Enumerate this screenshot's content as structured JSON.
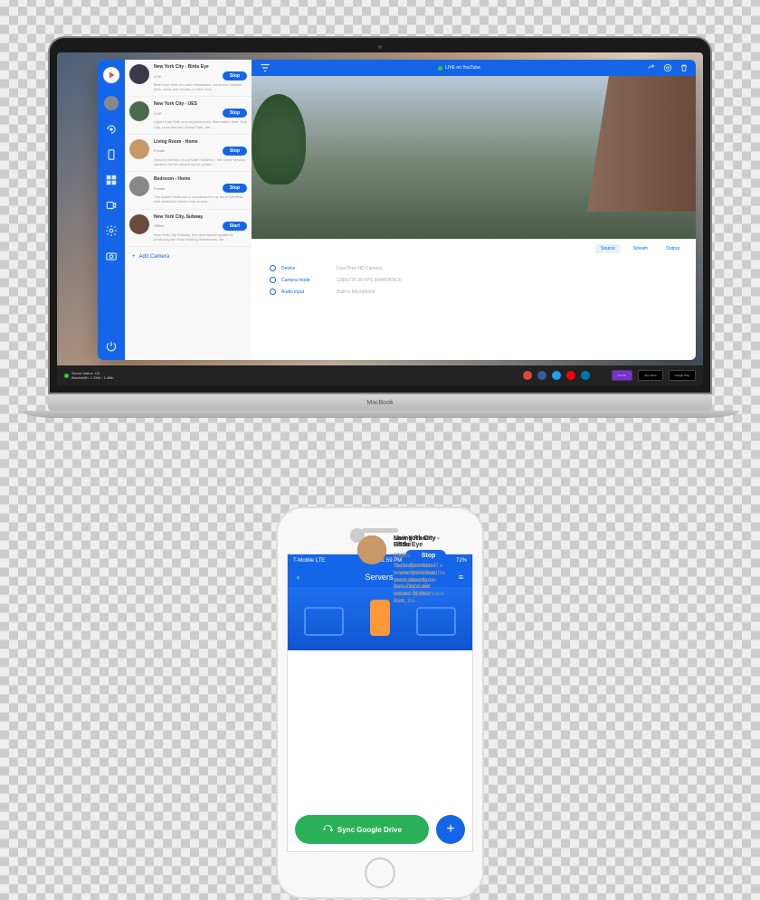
{
  "macbook_label": "MacBook",
  "topbar": {
    "live": "LIVE on YouTube"
  },
  "sidebar_icons": [
    "logo",
    "avatar",
    "camera",
    "phone",
    "grid",
    "record",
    "settings",
    "snapshot",
    "power"
  ],
  "cameras": [
    {
      "title": "New York City - Birds Eye",
      "status": "LIVE",
      "btn": "Stop",
      "desc": "Bird's eye view of Lower Manhattan, zoom into notable bars, clubs and venues of New York …",
      "thumb": "#3a3a4a"
    },
    {
      "title": "New York City - UES",
      "status": "LIVE",
      "btn": "Stop",
      "desc": "Upper East Side and neighborhood, Manhattan, New York City. Look around Central Park, the …",
      "thumb": "#4a6a4a"
    },
    {
      "title": "Living Room - Home",
      "status": "Private",
      "btn": "Stop",
      "desc": "Secured stream of a private residence, the home security camera can be viewed by it's creator …",
      "thumb": "#c89868"
    },
    {
      "title": "Bedroom - Home",
      "status": "Private",
      "btn": "Stop",
      "desc": "The master bedroom is connected to my list of cameras with restricted viewer only access …",
      "thumb": "#888"
    },
    {
      "title": "New York City, Subway",
      "status": "Offline",
      "btn": "Start",
      "desc": "New York City Subway, the rapid transit system is producing the most exciting livestreams, we …",
      "thumb": "#6a4a3a"
    }
  ],
  "add_camera": "Add Camera",
  "tabs": {
    "source": "Source",
    "stream": "Stream",
    "output": "Output"
  },
  "details": {
    "device": {
      "label": "Device",
      "value": "FaceTime HD Camera"
    },
    "mode": {
      "label": "Camera mode",
      "value": "1280x720 30 FPS (RAWVIDEO)"
    },
    "audio": {
      "label": "Audio input",
      "value": "Built-in Microphone"
    }
  },
  "footer": {
    "status": "Server status: OK",
    "bandwidth": "Bandwidth: 1.2Mb / 1.4Mb",
    "donate": "Donate",
    "appstore": "App Store",
    "gplay": "Google Play"
  },
  "phone": {
    "carrier": "T-Mobile  LTE",
    "time": "11:59 PM",
    "battery": "72%",
    "title": "Servers",
    "cameras": [
      {
        "title": "New York City - Birds Eye",
        "status": "LIVE",
        "btn": "Stop",
        "desc": "Bird's eye view of Lower Manhattan, zoom into notable bars, clubs and venues of New York …",
        "thumb": "#3a3a4a"
      },
      {
        "title": "New York City - UES",
        "status": "LIVE",
        "btn": "Stop",
        "desc": "Upper East Side and neighborhood, Manhattan, New York City. Look around Central Park, the …",
        "thumb": "#4a6a4a"
      },
      {
        "title": "Living Room - Home",
        "status": "Private",
        "btn": "Stop",
        "desc": "Secured stream of a private residence, the home security camera can be viewed by it's creator …",
        "thumb": "#c89868"
      }
    ],
    "sync": "Sync Google Drive"
  }
}
